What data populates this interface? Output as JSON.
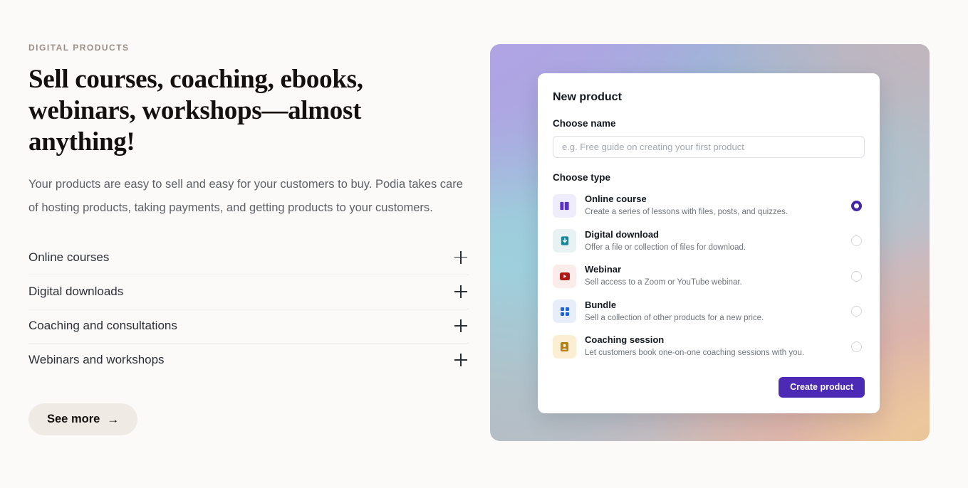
{
  "hero": {
    "eyebrow": "DIGITAL PRODUCTS",
    "headline": "Sell courses, coaching, ebooks, webinars, workshops—almost anything!",
    "subcopy": "Your products are easy to sell and easy for your customers to buy. Podia takes care of hosting products, taking payments, and getting products to your customers.",
    "see_more_label": "See more",
    "see_more_arrow": "→"
  },
  "accordion": {
    "items": [
      {
        "label": "Online courses",
        "toggle_icon": "plus-icon"
      },
      {
        "label": "Digital downloads",
        "toggle_icon": "plus-icon"
      },
      {
        "label": "Coaching and consultations",
        "toggle_icon": "plus-icon"
      },
      {
        "label": "Webinars and workshops",
        "toggle_icon": "plus-icon"
      }
    ]
  },
  "card": {
    "title": "New product",
    "name_label": "Choose name",
    "name_value": "",
    "name_placeholder": "e.g. Free guide on creating your first product",
    "type_label": "Choose type",
    "submit_label": "Create product",
    "types": [
      {
        "name": "Online course",
        "description": "Create a series of lessons with files, posts, and quizzes.",
        "icon": "book-columns-icon",
        "icon_bg": "#efecfb",
        "icon_fg": "#5b2fc9",
        "selected": true
      },
      {
        "name": "Digital download",
        "description": "Offer a file or collection of files for download.",
        "icon": "download-box-icon",
        "icon_bg": "#e8f2f2",
        "icon_fg": "#18879b",
        "selected": false
      },
      {
        "name": "Webinar",
        "description": "Sell access to a Zoom or YouTube webinar.",
        "icon": "play-video-icon",
        "icon_bg": "#fbecec",
        "icon_fg": "#b01818",
        "selected": false
      },
      {
        "name": "Bundle",
        "description": "Sell a collection of other products for a new price.",
        "icon": "grid-squares-icon",
        "icon_bg": "#e7eefa",
        "icon_fg": "#1a62d6",
        "selected": false
      },
      {
        "name": "Coaching session",
        "description": "Let customers book one-on-one coaching sessions with you.",
        "icon": "person-badge-icon",
        "icon_bg": "#fbeed2",
        "icon_fg": "#b87d11",
        "selected": false
      }
    ]
  },
  "colors": {
    "page_bg": "#fbfaf8",
    "accent_purple": "#4c2ab5",
    "radio_selected": "#4226a8",
    "pill_bg": "#f0eae5",
    "eyebrow": "#9b8d86"
  }
}
